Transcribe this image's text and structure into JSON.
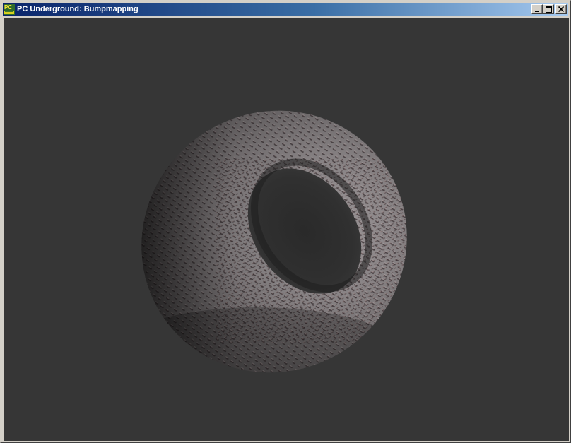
{
  "window": {
    "title": "PC Underground: Bumpmapping",
    "app_icon": "pc-underground-icon",
    "controls": {
      "minimize_icon": "minimize-icon",
      "maximize_icon": "maximize-icon",
      "close_icon": "close-icon"
    }
  },
  "viewport": {
    "background_color": "#363636",
    "object": "bump-mapped-torus"
  },
  "colors": {
    "titlebar_start": "#0a246a",
    "titlebar_end": "#a6caf0",
    "chrome": "#d4d0c8"
  }
}
